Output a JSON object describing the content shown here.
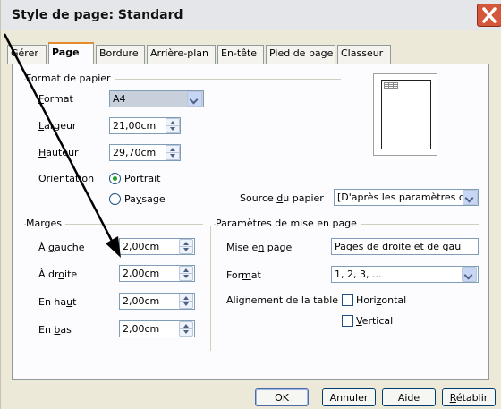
{
  "window": {
    "title": "Style de page: Standard"
  },
  "tabs": [
    "Gérer",
    "Page",
    "Bordure",
    "Arrière-plan",
    "En-tête",
    "Pied de page",
    "Classeur"
  ],
  "format_papier": {
    "heading": "Format de papier",
    "format_label": "Format",
    "format_value": "A4",
    "largeur_label": "Largeur",
    "largeur_value": "21,00cm",
    "hauteur_label": "Hauteur",
    "hauteur_value": "29,70cm",
    "orientation_label": "Orientation",
    "portrait_label": "Portrait",
    "paysage_label": "Paysage",
    "orientation_selected": "Portrait",
    "source_label": "Source du papier",
    "source_value": "[D'après les paramètres de"
  },
  "marges": {
    "heading": "Marges",
    "gauche_label": "À gauche",
    "gauche_value": "2,00cm",
    "droite_label": "À droite",
    "droite_value": "2,00cm",
    "haut_label": "En haut",
    "haut_value": "2,00cm",
    "bas_label": "En bas",
    "bas_value": "2,00cm"
  },
  "mise_en_page": {
    "heading": "Paramètres de mise en page",
    "mise_label": "Mise en page",
    "mise_value": "Pages de droite et de gau",
    "format_label": "Format",
    "format_value": "1, 2, 3, ...",
    "alignement_label": "Alignement de la table",
    "horizontal_label": "Horizontal",
    "vertical_label": "Vertical"
  },
  "buttons": {
    "ok": "OK",
    "cancel": "Annuler",
    "help": "Aide",
    "reset": "Rétablir"
  },
  "colors": {
    "title_close": "#d4573b",
    "active_tab_accent": "#e68b2c",
    "annotation_arrow": "#000000"
  },
  "icons": {
    "close": "close-icon",
    "spin": "spin-button-icon",
    "dropdown": "chevron-down-icon"
  }
}
